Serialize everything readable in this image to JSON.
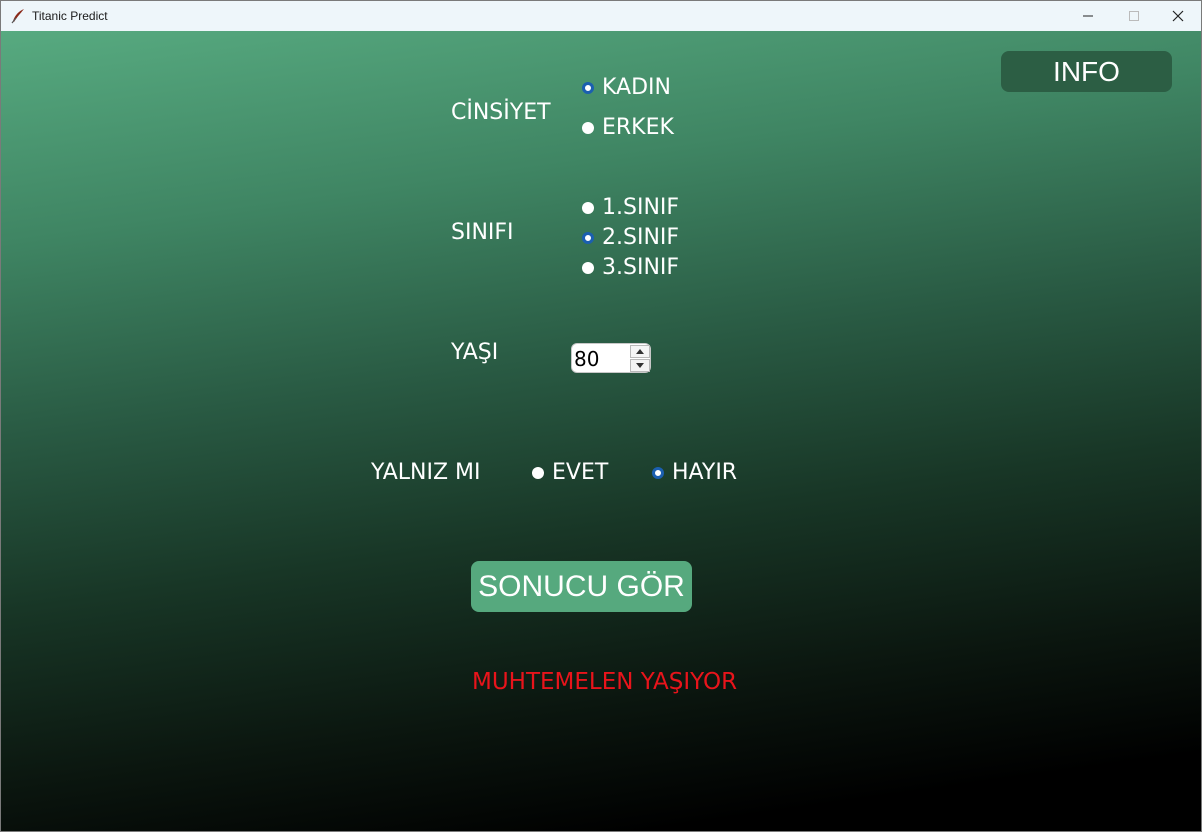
{
  "window": {
    "title": "Titanic Predict"
  },
  "info_button": "INFO",
  "gender": {
    "label": "CİNSİYET",
    "options": [
      "KADIN",
      "ERKEK"
    ],
    "selected": "KADIN"
  },
  "pclass": {
    "label": "SINIFI",
    "options": [
      "1.SINIF",
      "2.SINIF",
      "3.SINIF"
    ],
    "selected": "2.SINIF"
  },
  "age": {
    "label": "YAŞI",
    "value": "80"
  },
  "alone": {
    "label": "YALNIZ MI",
    "options": [
      "EVET",
      "HAYIR"
    ],
    "selected": "HAYIR"
  },
  "submit_button": "SONUCU GÖR",
  "result_text": "MUHTEMELEN YAŞIYOR",
  "colors": {
    "result": "#e8141b",
    "button": "#56a97e",
    "info_button": "#2c5e44",
    "radio_selected": "#1b5fb0"
  }
}
